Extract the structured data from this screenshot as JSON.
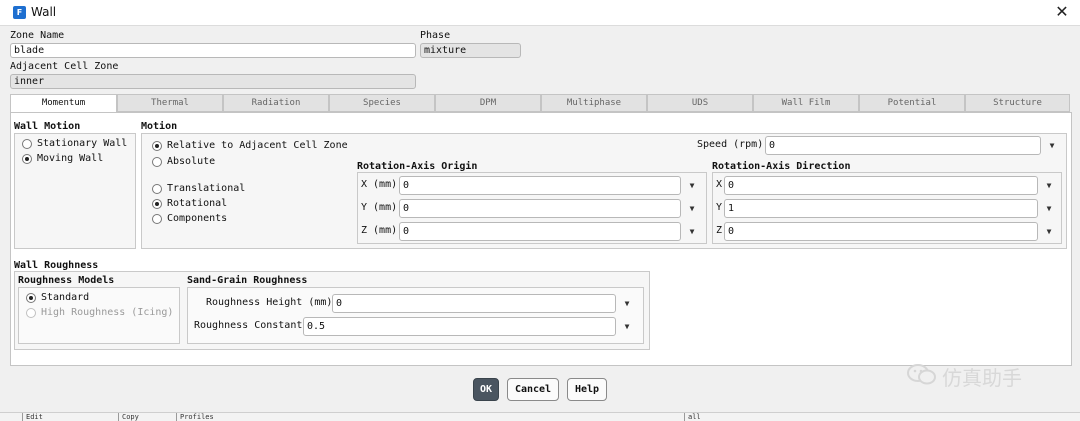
{
  "window": {
    "title": "Wall",
    "app_icon_letter": "F",
    "close_glyph": "✕"
  },
  "zone": {
    "zone_name_label": "Zone Name",
    "zone_name_value": "blade",
    "phase_label": "Phase",
    "phase_value": "mixture",
    "adjacent_label": "Adjacent Cell Zone",
    "adjacent_value": "inner"
  },
  "tabs": [
    {
      "label": "Momentum",
      "active": true
    },
    {
      "label": "Thermal"
    },
    {
      "label": "Radiation"
    },
    {
      "label": "Species"
    },
    {
      "label": "DPM"
    },
    {
      "label": "Multiphase"
    },
    {
      "label": "UDS"
    },
    {
      "label": "Wall Film"
    },
    {
      "label": "Potential"
    },
    {
      "label": "Structure"
    }
  ],
  "wall_motion": {
    "title": "Wall Motion",
    "options": [
      "Stationary Wall",
      "Moving Wall"
    ],
    "selected": 1
  },
  "motion": {
    "title": "Motion",
    "reference_options": [
      "Relative to Adjacent Cell Zone",
      "Absolute"
    ],
    "reference_selected": 0,
    "type_options": [
      "Translational",
      "Rotational",
      "Components"
    ],
    "type_selected": 1,
    "speed_label": "Speed (rpm)",
    "speed_value": "0",
    "origin": {
      "title": "Rotation-Axis Origin",
      "x_label": "X (mm)",
      "x_value": "0",
      "y_label": "Y (mm)",
      "y_value": "0",
      "z_label": "Z (mm)",
      "z_value": "0"
    },
    "direction": {
      "title": "Rotation-Axis Direction",
      "x_label": "X",
      "x_value": "0",
      "y_label": "Y",
      "y_value": "1",
      "z_label": "Z",
      "z_value": "0"
    }
  },
  "roughness": {
    "title": "Wall Roughness",
    "models_title": "Roughness Models",
    "model_options": [
      "Standard",
      "High Roughness (Icing)"
    ],
    "model_selected": 0,
    "sand_title": "Sand-Grain Roughness",
    "height_label": "Roughness Height (mm)",
    "height_value": "0",
    "constant_label": "Roughness Constant",
    "constant_value": "0.5"
  },
  "buttons": {
    "ok": "OK",
    "cancel": "Cancel",
    "help": "Help"
  },
  "watermark": "仿真助手",
  "background_strip": [
    "Edit",
    "Copy",
    "Profiles",
    "all"
  ],
  "dropdown_glyph": "▼"
}
